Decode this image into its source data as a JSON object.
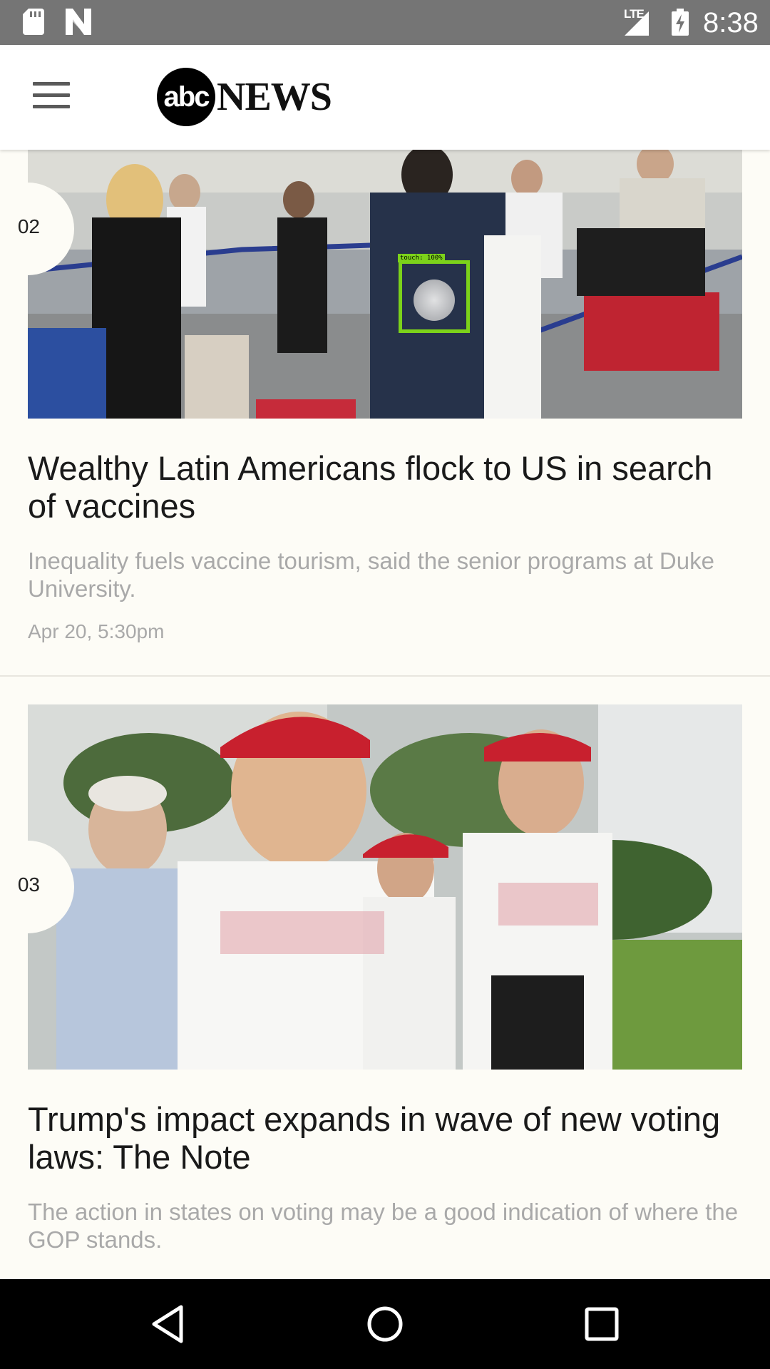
{
  "status_bar": {
    "time": "8:38",
    "network": "LTE",
    "icons": [
      "sd-card-icon",
      "n-notification-icon",
      "signal-icon",
      "battery-charging-icon"
    ]
  },
  "app_bar": {
    "logo_mark": "abc",
    "logo_word": "NEWS",
    "menu_icon": "hamburger-menu-icon"
  },
  "articles": [
    {
      "rank": "02",
      "headline": "Wealthy Latin Americans flock to US in search of vaccines",
      "summary": "Inequality fuels vaccine tourism, said the senior programs at Duke University.",
      "timestamp": "Apr 20, 5:30pm",
      "image_desc": "travelers waiting in airport check-in line"
    },
    {
      "rank": "03",
      "headline": "Trump's impact expands in wave of new voting laws: The Note",
      "summary": "The action in states on voting may be a good indication of where the GOP stands.",
      "image_desc": "people wearing Trump DeSantis shirts and red caps"
    }
  ],
  "touch_indicator": {
    "label": "touch: 100%"
  },
  "nav_bar": {
    "back": "back-icon",
    "home": "home-icon",
    "recents": "recents-icon"
  },
  "colors": {
    "status_bar": "#757575",
    "background": "#fdfcf6",
    "headline": "#1a1a1a",
    "summary": "#a9a9a9",
    "touch_box": "#7cd21a"
  }
}
